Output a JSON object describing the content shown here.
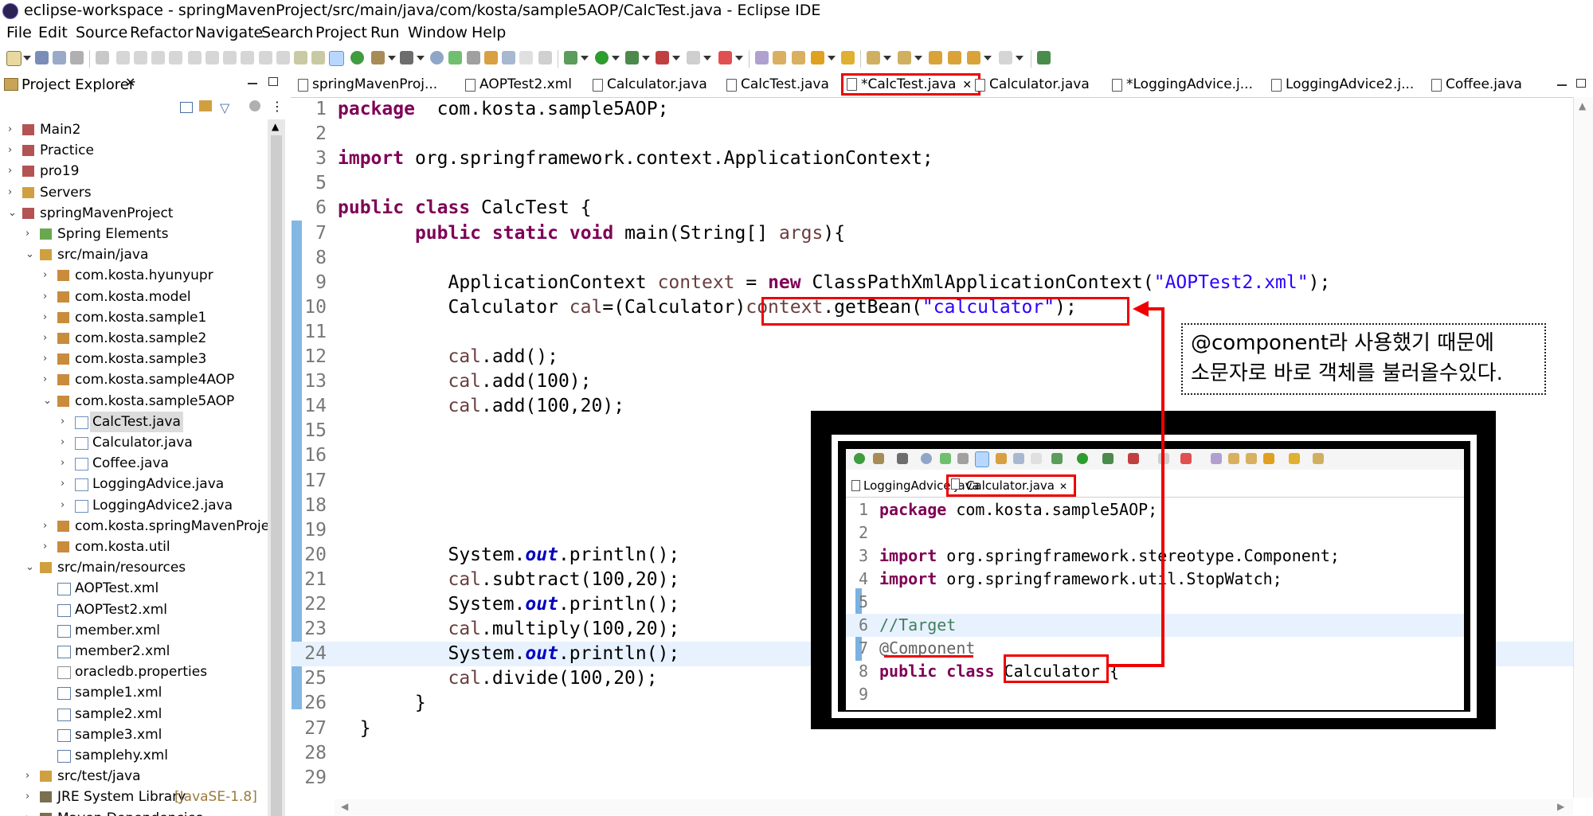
{
  "window": {
    "title": "eclipse-workspace - springMavenProject/src/main/java/com/kosta/sample5AOP/CalcTest.java - Eclipse IDE"
  },
  "menu": [
    "File",
    "Edit",
    "Source",
    "Refactor",
    "Navigate",
    "Search",
    "Project",
    "Run",
    "Window",
    "Help"
  ],
  "project_explorer": {
    "title": "Project Explorer",
    "tree": [
      {
        "label": "Main2",
        "twisty": "›"
      },
      {
        "label": "Practice",
        "twisty": "›"
      },
      {
        "label": "pro19",
        "twisty": "›"
      },
      {
        "label": "Servers",
        "twisty": "›"
      },
      {
        "label": "springMavenProject",
        "twisty": "⌄"
      },
      {
        "label": "Spring Elements",
        "twisty": "›"
      },
      {
        "label": "src/main/java",
        "twisty": "⌄"
      },
      {
        "label": "com.kosta.hyunyupr",
        "twisty": "›"
      },
      {
        "label": "com.kosta.model",
        "twisty": "›"
      },
      {
        "label": "com.kosta.sample1",
        "twisty": "›"
      },
      {
        "label": "com.kosta.sample2",
        "twisty": "›"
      },
      {
        "label": "com.kosta.sample3",
        "twisty": "›"
      },
      {
        "label": "com.kosta.sample4AOP",
        "twisty": "›"
      },
      {
        "label": "com.kosta.sample5AOP",
        "twisty": "⌄"
      },
      {
        "label": "CalcTest.java",
        "twisty": "›"
      },
      {
        "label": "Calculator.java",
        "twisty": "›"
      },
      {
        "label": "Coffee.java",
        "twisty": "›"
      },
      {
        "label": "LoggingAdvice.java",
        "twisty": "›"
      },
      {
        "label": "LoggingAdvice2.java",
        "twisty": "›"
      },
      {
        "label": "com.kosta.springMavenProject",
        "twisty": "›"
      },
      {
        "label": "com.kosta.util",
        "twisty": "›"
      },
      {
        "label": "src/main/resources",
        "twisty": "⌄"
      },
      {
        "label": "AOPTest.xml",
        "twisty": ""
      },
      {
        "label": "AOPTest2.xml",
        "twisty": ""
      },
      {
        "label": "member.xml",
        "twisty": ""
      },
      {
        "label": "member2.xml",
        "twisty": ""
      },
      {
        "label": "oracledb.properties",
        "twisty": ""
      },
      {
        "label": "sample1.xml",
        "twisty": ""
      },
      {
        "label": "sample2.xml",
        "twisty": ""
      },
      {
        "label": "sample3.xml",
        "twisty": ""
      },
      {
        "label": "samplehy.xml",
        "twisty": ""
      },
      {
        "label": "src/test/java",
        "twisty": "›"
      },
      {
        "label": "JRE System Library",
        "twisty": "›",
        "suffix": "[JavaSE-1.8]"
      },
      {
        "label": "Maven Dependencies",
        "twisty": "›"
      }
    ]
  },
  "editor_tabs": [
    "springMavenProj...",
    "AOPTest2.xml",
    "Calculator.java",
    "CalcTest.java",
    "*CalcTest.java",
    "Calculator.java",
    "*LoggingAdvice.j...",
    "LoggingAdvice2.j...",
    "Coffee.java"
  ],
  "code_lines": [
    {
      "n": "1",
      "segs": [
        [
          "kw",
          "package"
        ],
        [
          "",
          "  com.kosta.sample5AOP;"
        ]
      ]
    },
    {
      "n": "2",
      "segs": []
    },
    {
      "n": "3",
      "segs": [
        [
          "kw",
          "import"
        ],
        [
          "",
          " org.springframework.context.ApplicationContext;"
        ]
      ]
    },
    {
      "n": "5",
      "segs": []
    },
    {
      "n": "6",
      "segs": [
        [
          "kw",
          "public"
        ],
        [
          "",
          " "
        ],
        [
          "kw",
          "class"
        ],
        [
          "",
          " CalcTest {"
        ]
      ]
    },
    {
      "n": "7",
      "segs": [
        [
          "",
          "       "
        ],
        [
          "kw",
          "public"
        ],
        [
          "",
          " "
        ],
        [
          "kw",
          "static"
        ],
        [
          "",
          " "
        ],
        [
          "kw",
          "void"
        ],
        [
          "",
          " main(String[] "
        ],
        [
          "lv",
          "args"
        ],
        [
          "",
          "){"
        ]
      ]
    },
    {
      "n": "8",
      "segs": []
    },
    {
      "n": "9",
      "segs": [
        [
          "",
          "          ApplicationContext "
        ],
        [
          "lv",
          "context"
        ],
        [
          "",
          " = "
        ],
        [
          "kw",
          "new"
        ],
        [
          "",
          " ClassPathXmlApplicationContext("
        ],
        [
          "str",
          "\"AOPTest2.xml\""
        ],
        [
          "",
          ");"
        ]
      ]
    },
    {
      "n": "10",
      "segs": [
        [
          "",
          "          Calculator "
        ],
        [
          "lv",
          "cal"
        ],
        [
          "",
          "=(Calculator)"
        ],
        [
          "lv",
          "context"
        ],
        [
          "",
          ".getBean("
        ],
        [
          "str",
          "\"calculator\""
        ],
        [
          "",
          ");"
        ]
      ]
    },
    {
      "n": "11",
      "segs": []
    },
    {
      "n": "12",
      "segs": [
        [
          "",
          "          "
        ],
        [
          "lv",
          "cal"
        ],
        [
          "",
          ".add();"
        ]
      ]
    },
    {
      "n": "13",
      "segs": [
        [
          "",
          "          "
        ],
        [
          "lv",
          "cal"
        ],
        [
          "",
          ".add(100);"
        ]
      ]
    },
    {
      "n": "14",
      "segs": [
        [
          "",
          "          "
        ],
        [
          "lv",
          "cal"
        ],
        [
          "",
          ".add(100,20);"
        ]
      ]
    },
    {
      "n": "15",
      "segs": []
    },
    {
      "n": "16",
      "segs": []
    },
    {
      "n": "17",
      "segs": []
    },
    {
      "n": "18",
      "segs": []
    },
    {
      "n": "19",
      "segs": []
    },
    {
      "n": "20",
      "segs": [
        [
          "",
          "          System."
        ],
        [
          "fld",
          "out"
        ],
        [
          "",
          ".println();"
        ]
      ]
    },
    {
      "n": "21",
      "segs": [
        [
          "",
          "          "
        ],
        [
          "lv",
          "cal"
        ],
        [
          "",
          ".subtract(100,20);"
        ]
      ]
    },
    {
      "n": "22",
      "segs": [
        [
          "",
          "          System."
        ],
        [
          "fld",
          "out"
        ],
        [
          "",
          ".println();"
        ]
      ]
    },
    {
      "n": "23",
      "segs": [
        [
          "",
          "          "
        ],
        [
          "lv",
          "cal"
        ],
        [
          "",
          ".multiply(100,20);"
        ]
      ]
    },
    {
      "n": "24",
      "segs": [
        [
          "",
          "          System."
        ],
        [
          "fld",
          "out"
        ],
        [
          "",
          ".println();"
        ]
      ]
    },
    {
      "n": "25",
      "segs": [
        [
          "",
          "          "
        ],
        [
          "lv",
          "cal"
        ],
        [
          "",
          ".divide(100,20);"
        ]
      ]
    },
    {
      "n": "26",
      "segs": [
        [
          "",
          "       }"
        ]
      ]
    },
    {
      "n": "27",
      "segs": [
        [
          "",
          "  }"
        ]
      ]
    },
    {
      "n": "28",
      "segs": []
    },
    {
      "n": "29",
      "segs": []
    }
  ],
  "callout": {
    "line1": "@component라 사용했기 때문에",
    "line2": "소문자로 바로 객체를 불러올수있다."
  },
  "inset": {
    "tabs": [
      "LoggingAdvice.java",
      "Calculator.java"
    ],
    "code_lines": [
      {
        "n": "1",
        "segs": [
          [
            "kw",
            "package"
          ],
          [
            "",
            " com.kosta.sample5AOP;"
          ]
        ]
      },
      {
        "n": "2",
        "segs": []
      },
      {
        "n": "3",
        "segs": [
          [
            "kw",
            "import"
          ],
          [
            "",
            " org.springframework.stereotype.Component;"
          ]
        ]
      },
      {
        "n": "4",
        "segs": [
          [
            "kw",
            "import"
          ],
          [
            "",
            " org.springframework.util.StopWatch;"
          ]
        ]
      },
      {
        "n": "5",
        "segs": []
      },
      {
        "n": "6",
        "segs": [
          [
            "cm",
            "//Target"
          ]
        ]
      },
      {
        "n": "7",
        "segs": [
          [
            "an",
            "@Component"
          ]
        ]
      },
      {
        "n": "8",
        "segs": [
          [
            "kw",
            "public"
          ],
          [
            "",
            " "
          ],
          [
            "kw",
            "class"
          ],
          [
            "",
            " Calculator {"
          ]
        ]
      },
      {
        "n": "9",
        "segs": []
      }
    ]
  },
  "colors": {
    "annotation_red": "#ef0000",
    "keyword": "#7f0055",
    "string": "#2a00ff",
    "field": "#0000c0"
  }
}
